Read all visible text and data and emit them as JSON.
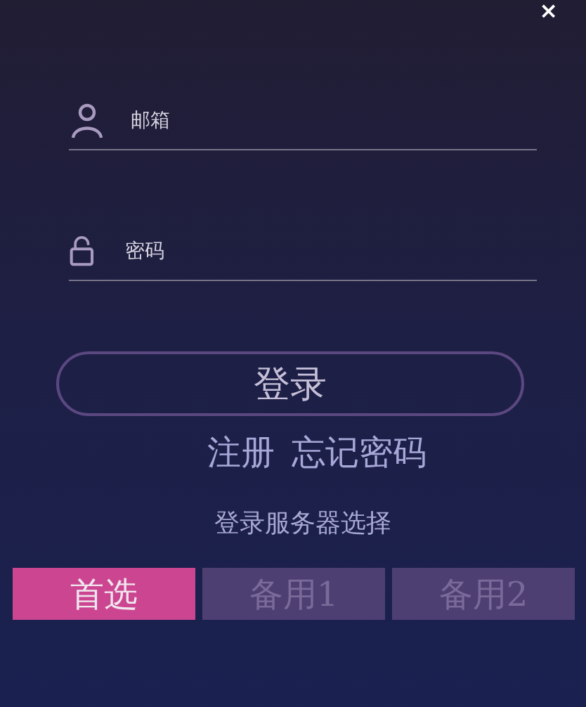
{
  "close": "×",
  "fields": [
    {
      "kind": "user",
      "placeholder": "邮箱"
    },
    {
      "kind": "lock",
      "placeholder": "密码"
    }
  ],
  "login_button": "登录",
  "links": [
    "注册",
    "忘记密码"
  ],
  "server_label": "登录服务器选择",
  "servers": [
    {
      "label": "首选",
      "selected": true
    },
    {
      "label": "备用1",
      "selected": false
    },
    {
      "label": "备用2",
      "selected": false
    }
  ]
}
